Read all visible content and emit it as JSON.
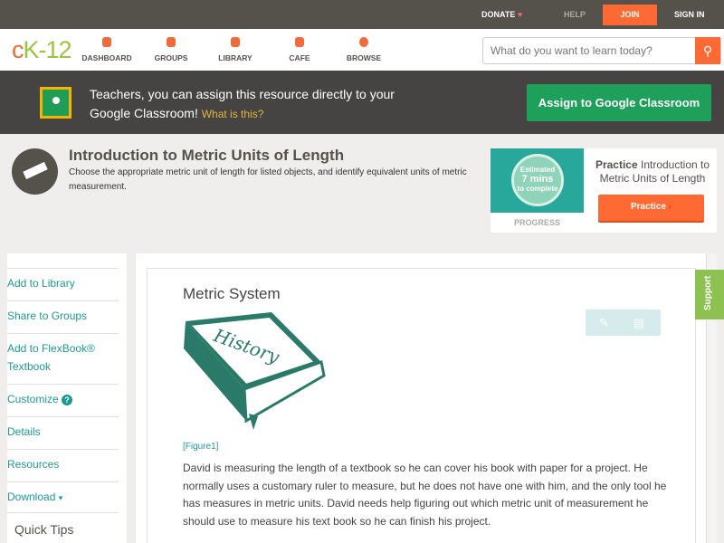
{
  "topbar": {
    "donate": "DONATE",
    "help": "HELP",
    "join": "JOIN",
    "signin": "SIGN IN"
  },
  "nav": {
    "logo": "cK-12",
    "items": [
      {
        "label": "DASHBOARD",
        "icon": "dashboard-icon"
      },
      {
        "label": "GROUPS",
        "icon": "groups-icon"
      },
      {
        "label": "LIBRARY",
        "icon": "library-icon"
      },
      {
        "label": "CAFE",
        "icon": "cafe-icon"
      },
      {
        "label": "BROWSE",
        "icon": "browse-icon"
      }
    ],
    "search_placeholder": "What do you want to learn today?"
  },
  "classroom": {
    "text": "Teachers, you can assign this resource directly to your Google Classroom!",
    "what": "What is this?",
    "button": "Assign to Google Classroom"
  },
  "header": {
    "title": "Introduction to Metric Units of Length",
    "description": "Choose the appropriate metric unit of length for listed objects, and identify equivalent units of metric measurement."
  },
  "practice": {
    "estimated": "Estimated",
    "mins": "7 mins",
    "complete": "to complete",
    "progress": "PROGRESS",
    "title_bold": "Practice",
    "title_rest": " Introduction to Metric Units of Length",
    "button": "Practice"
  },
  "sidebar": {
    "items": [
      "Add to Library",
      "Share to Groups",
      "Add to FlexBook® Textbook",
      "Customize",
      "Details",
      "Resources",
      "Download"
    ],
    "help": "?",
    "download_caret": "▾",
    "quick_tips": "Quick Tips"
  },
  "support": "Support",
  "content": {
    "section_title": "Metric System",
    "book_label": "History",
    "figure": "[Figure1]",
    "paragraph": "David is measuring the length of a textbook so he can cover his book with paper for a project. He normally uses a customary ruler to measure, but he does not have one with him, and the only tool he has measures in metric units. David needs help figuring out which metric unit of measurement he should use to measure his text book so he can finish his project."
  }
}
